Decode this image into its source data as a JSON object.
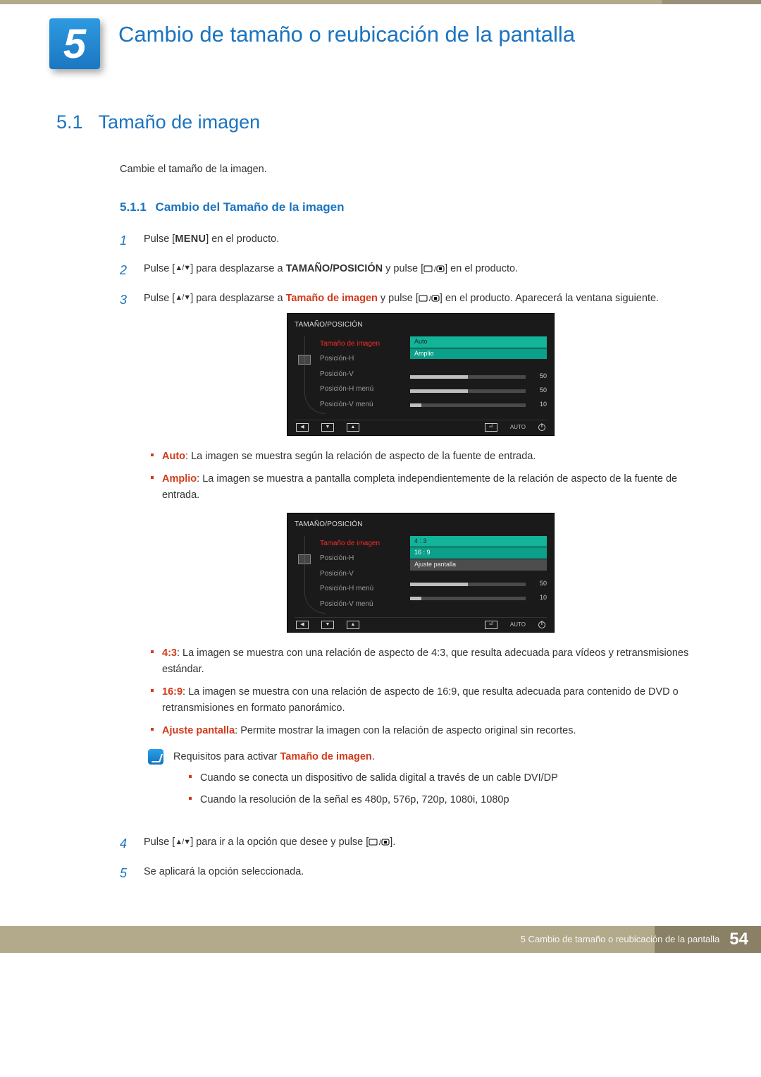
{
  "chapter": {
    "number": "5",
    "title": "Cambio de tamaño o reubicación de la pantalla"
  },
  "section": {
    "number": "5.1",
    "title": "Tamaño de imagen"
  },
  "intro": "Cambie el tamaño de la imagen.",
  "subsection": {
    "number": "5.1.1",
    "title": "Cambio del Tamaño de la imagen"
  },
  "steps": {
    "s1a": "Pulse [",
    "s1_menu": "MENU",
    "s1b": "] en el producto.",
    "s2a": "Pulse [",
    "s2b": "] para desplazarse a ",
    "s2_target": "TAMAÑO/POSICIÓN",
    "s2c": " y pulse [",
    "s2d": "] en el producto.",
    "s3a": "Pulse [",
    "s3b": "] para desplazarse a ",
    "s3_target": "Tamaño de imagen",
    "s3c": " y pulse [",
    "s3d": "] en el producto. Aparecerá la ventana siguiente.",
    "s4a": "Pulse [",
    "s4b": "] para ir a la opción que desee y pulse [",
    "s4c": "].",
    "s5": "Se aplicará la opción seleccionada."
  },
  "osd1": {
    "title": "TAMAÑO/POSICIÓN",
    "items": [
      "Tamaño de imagen",
      "Posición-H",
      "Posición-V",
      "Posición-H menú",
      "Posición-V menú"
    ],
    "opts": [
      "Auto",
      "Amplio"
    ],
    "sliders": [
      {
        "value": "50",
        "pct": 50
      },
      {
        "value": "50",
        "pct": 50
      },
      {
        "value": "10",
        "pct": 10
      }
    ],
    "foot_auto": "AUTO"
  },
  "osd2": {
    "title": "TAMAÑO/POSICIÓN",
    "items": [
      "Tamaño de imagen",
      "Posición-H",
      "Posición-V",
      "Posición-H menú",
      "Posición-V menú"
    ],
    "opts": [
      "4 : 3",
      "16 : 9",
      "Ajuste pantalla"
    ],
    "sliders": [
      {
        "value": "50",
        "pct": 50
      },
      {
        "value": "10",
        "pct": 10
      }
    ],
    "foot_auto": "AUTO"
  },
  "bullets1": {
    "b1_term": "Auto",
    "b1_text": ": La imagen se muestra según la relación de aspecto de la fuente de entrada.",
    "b2_term": "Amplio",
    "b2_text": ": La imagen se muestra a pantalla completa independientemente de la relación de aspecto de la fuente de entrada."
  },
  "bullets2": {
    "b1_term": "4:3",
    "b1_text": ": La imagen se muestra con una relación de aspecto de 4:3, que resulta adecuada para vídeos y retransmisiones estándar.",
    "b2_term": "16:9",
    "b2_text": ": La imagen se muestra con una relación de aspecto de 16:9, que resulta adecuada para contenido de DVD o retransmisiones en formato panorámico.",
    "b3_term": "Ajuste pantalla",
    "b3_text": ": Permite mostrar la imagen con la relación de aspecto original sin recortes."
  },
  "note": {
    "lead_a": "Requisitos para activar ",
    "lead_term": "Tamaño de imagen",
    "lead_b": ".",
    "n1": "Cuando se conecta un dispositivo de salida digital a través de un cable DVI/DP",
    "n2": "Cuando la resolución de la señal es 480p, 576p, 720p, 1080i, 1080p"
  },
  "footer": {
    "text": "5 Cambio de tamaño o reubicación de la pantalla",
    "page": "54"
  }
}
